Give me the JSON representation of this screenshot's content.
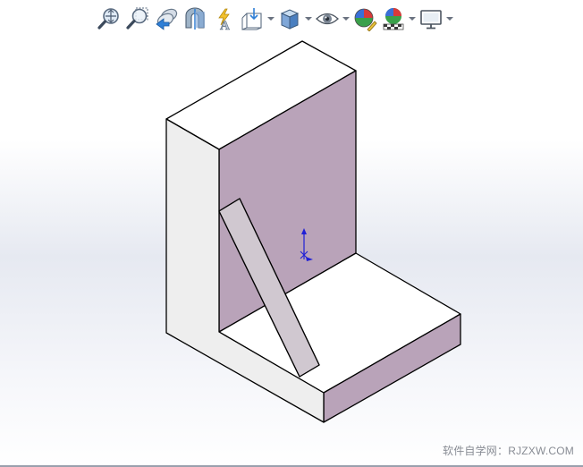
{
  "toolbar": {
    "items": [
      {
        "icon": "zoom-to-fit-icon",
        "dropdown": false
      },
      {
        "icon": "zoom-to-area-icon",
        "dropdown": false
      },
      {
        "icon": "previous-view-icon",
        "dropdown": false
      },
      {
        "icon": "section-view-icon",
        "dropdown": false
      },
      {
        "icon": "dynamic-annotation-views-icon",
        "dropdown": false
      },
      {
        "icon": "view-orientation-icon",
        "dropdown": true
      },
      {
        "icon": "display-style-icon",
        "dropdown": true
      },
      {
        "icon": "hide-show-items-icon",
        "dropdown": true
      },
      {
        "icon": "edit-appearance-icon",
        "dropdown": false
      },
      {
        "icon": "apply-scene-icon",
        "dropdown": true
      },
      {
        "icon": "view-settings-icon",
        "dropdown": true
      }
    ]
  },
  "colors": {
    "top_face": "#ffffff",
    "side_face": "#eeeeee",
    "back_face": "#b9a3b9",
    "gusset_face": "#d0c8d0",
    "edge": "#000000",
    "triad": "#1f1fd6"
  },
  "watermark": "软件自学网：RJZXW.COM"
}
